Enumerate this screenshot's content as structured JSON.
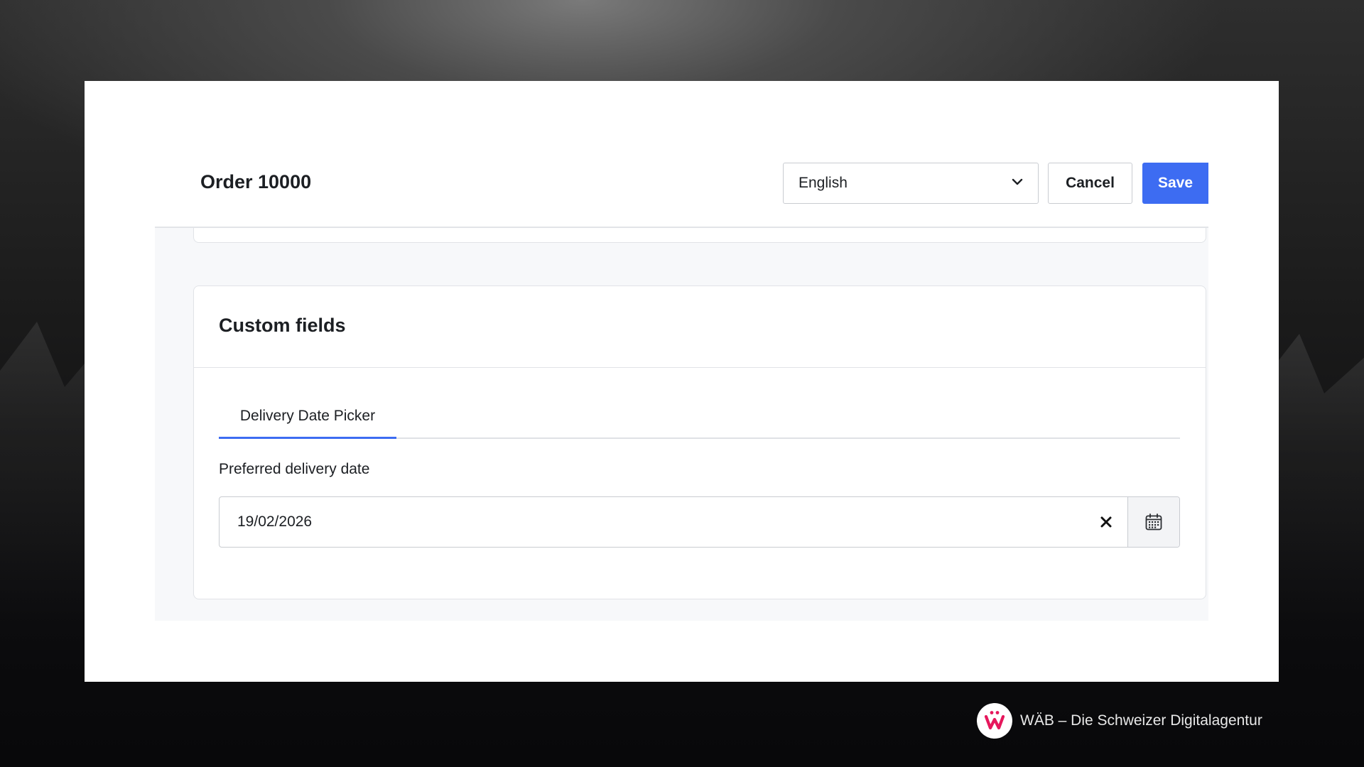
{
  "header": {
    "title": "Order 10000",
    "language": {
      "selected": "English"
    },
    "cancel_label": "Cancel",
    "save_label": "Save"
  },
  "custom_fields": {
    "title": "Custom fields",
    "tabs": [
      {
        "label": "Delivery Date Picker",
        "active": true
      }
    ],
    "field": {
      "label": "Preferred delivery date",
      "value": "19/02/2026"
    }
  },
  "branding": {
    "text": "WÄB – Die Schweizer Digitalagentur",
    "logo_icon": "waeb-w-logo-icon"
  },
  "colors": {
    "accent": "#3d6cf2",
    "logo": "#e6175c"
  }
}
